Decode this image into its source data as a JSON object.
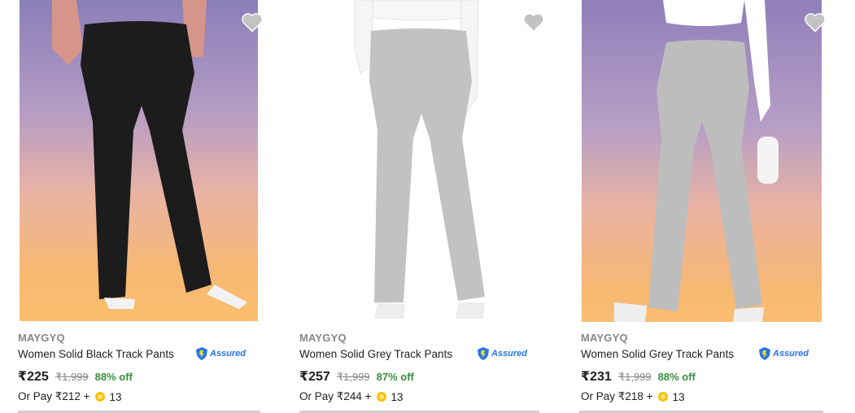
{
  "products": [
    {
      "brand": "MAYGYQ",
      "title": "Women Solid Black Track Pants",
      "assured_label": "Assured",
      "price": "₹225",
      "mrp": "₹1,999",
      "discount": "88% off",
      "pay_prefix": "Or Pay ₹212 +",
      "coins": "13",
      "image": {
        "pants_color": "#1c1c1c",
        "background": "sunset-gradient"
      }
    },
    {
      "brand": "MAYGYQ",
      "title": "Women Solid Grey Track Pants",
      "assured_label": "Assured",
      "price": "₹257",
      "mrp": "₹1,999",
      "discount": "87% off",
      "pay_prefix": "Or Pay ₹244 +",
      "coins": "13",
      "image": {
        "pants_color": "#c2c2c2",
        "background": "white"
      }
    },
    {
      "brand": "MAYGYQ",
      "title": "Women Solid Grey Track Pants",
      "assured_label": "Assured",
      "price": "₹231",
      "mrp": "₹1,999",
      "discount": "88% off",
      "pay_prefix": "Or Pay ₹218 +",
      "coins": "13",
      "image": {
        "pants_color": "#bdbdbd",
        "background": "sunset-gradient"
      }
    }
  ],
  "icons": {
    "wishlist": "heart-icon",
    "assured": "shield-icon",
    "coin": "coin-icon"
  },
  "colors": {
    "discount": "#388e3c",
    "assured": "#2874f0",
    "muted": "#878787",
    "wishlist": "#c2c2c2"
  }
}
